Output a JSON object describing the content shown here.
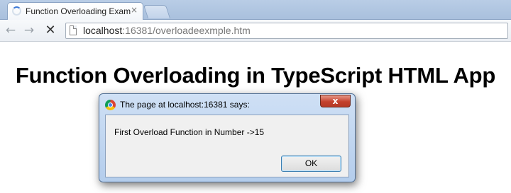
{
  "browser": {
    "tab": {
      "title": "Function Overloading Exam",
      "close_glyph": "×",
      "loading_icon": "loading-spinner-icon"
    },
    "toolbar": {
      "back_glyph": "←",
      "forward_glyph": "→",
      "stop_glyph": "✕",
      "url_host": "localhost",
      "url_rest": ":16381/overloadeexmple.htm"
    }
  },
  "page": {
    "heading": "Function Overloading in TypeScript HTML App"
  },
  "dialog": {
    "title": "The page at localhost:16381 says:",
    "close_glyph": "x",
    "message": "First Overload Function in Number ->15",
    "ok_label": "OK"
  },
  "colors": {
    "tabstrip": "#b9cde6",
    "dialog_frame": "#cfe0f5",
    "close_button": "#c4412d",
    "ok_border": "#3c7fb1"
  }
}
